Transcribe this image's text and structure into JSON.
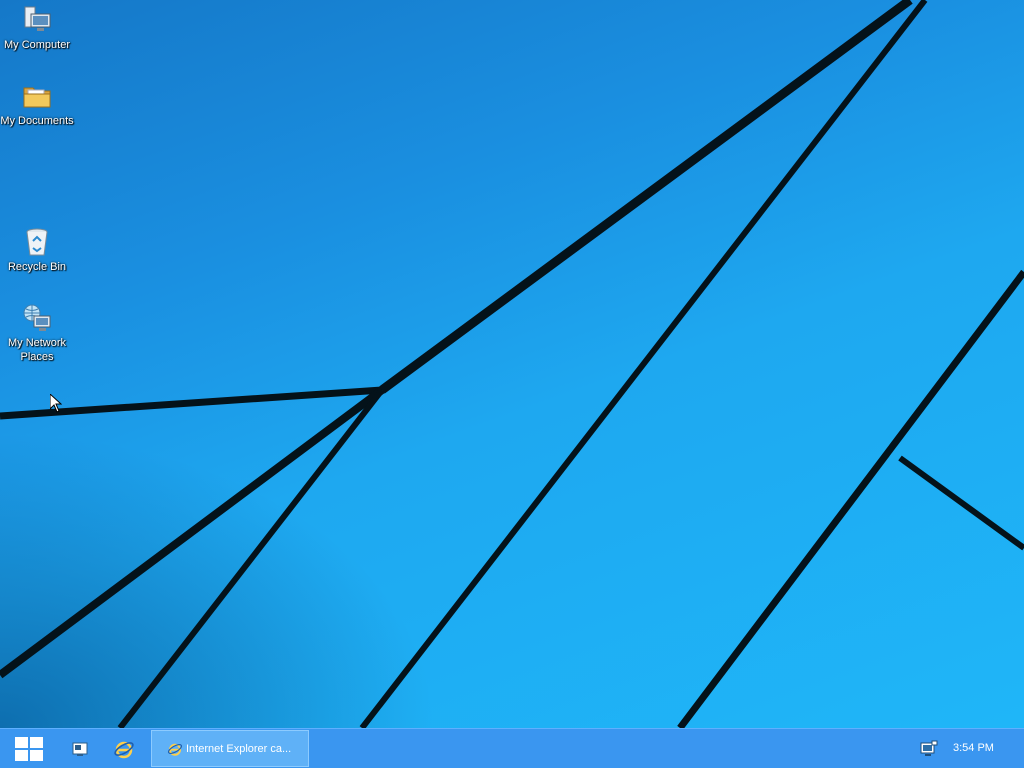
{
  "desktop": {
    "icons": [
      {
        "label": "My Computer",
        "icon": "computer-icon"
      },
      {
        "label": "My Documents",
        "icon": "folder-icon"
      },
      {
        "label": "Recycle Bin",
        "icon": "recycle-bin-icon"
      },
      {
        "label": "My Network Places",
        "icon": "network-places-icon"
      }
    ]
  },
  "taskbar": {
    "start_icon": "windows-logo-icon",
    "quicklaunch": [
      {
        "icon": "show-desktop-icon"
      },
      {
        "icon": "internet-explorer-icon"
      }
    ],
    "tasks": [
      {
        "label": "Internet Explorer ca...",
        "icon": "internet-explorer-icon",
        "active": true
      }
    ],
    "tray": {
      "network_icon": "network-monitor-icon",
      "clock": "3:54 PM"
    }
  },
  "colors": {
    "taskbar": "#3a96f0",
    "wallpaper": "#1fa6ee",
    "wallpaper_lines": "#04121a"
  }
}
